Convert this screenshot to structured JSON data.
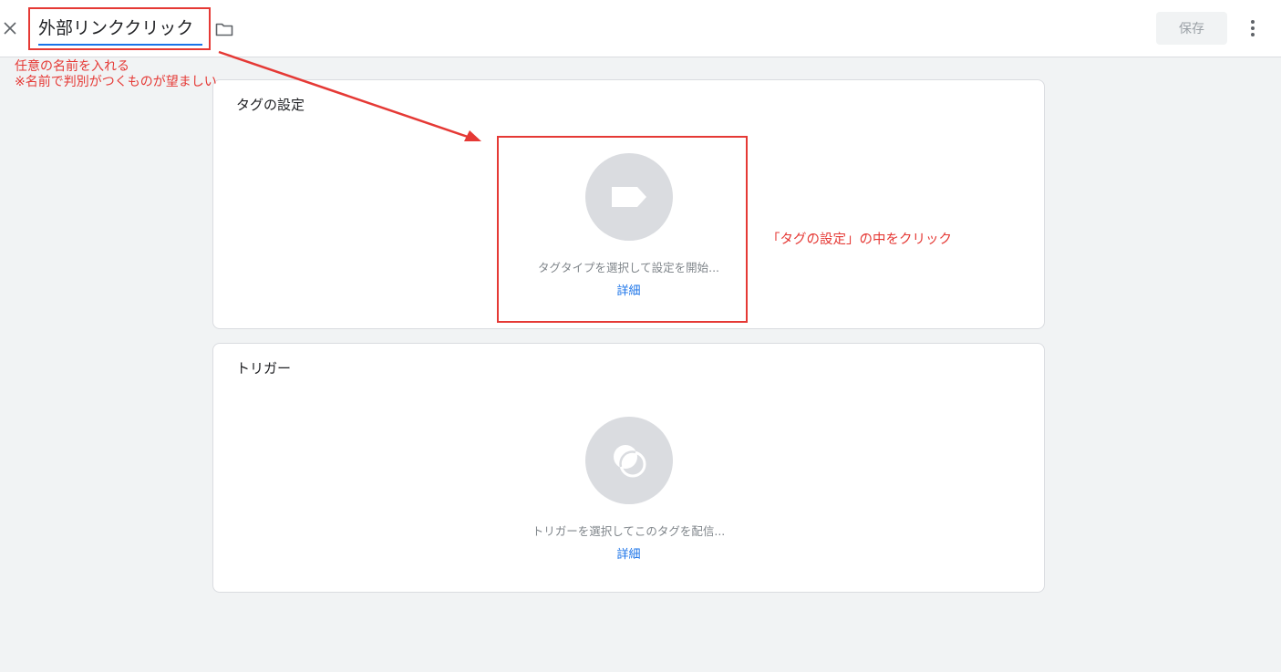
{
  "header": {
    "tag_name_value": "外部リンククリック",
    "save_label": "保存",
    "close_icon": "close-icon",
    "folder_icon": "folder-icon",
    "more_icon": "more-vert-icon"
  },
  "tag_config": {
    "title": "タグの設定",
    "icon": "tag-icon",
    "placeholder": "タグタイプを選択して設定を開始...",
    "detail_link": "詳細"
  },
  "trigger": {
    "title": "トリガー",
    "icon": "trigger-icon",
    "placeholder": "トリガーを選択してこのタグを配信...",
    "detail_link": "詳細"
  },
  "annotations": {
    "name_hint_line1": "任意の名前を入れる",
    "name_hint_line2": "※名前で判別がつくものが望ましい",
    "tag_config_hint": "「タグの設定」の中をクリック",
    "color": "#e53935"
  },
  "colors": {
    "accent": "#1a73e8",
    "background": "#f1f3f4",
    "annotation": "#e53935"
  }
}
